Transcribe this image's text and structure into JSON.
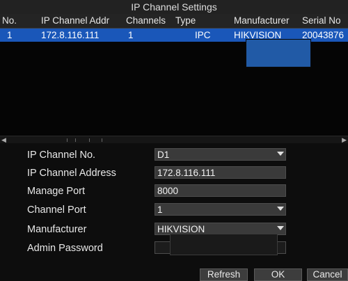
{
  "window": {
    "title": "IP Channel Settings"
  },
  "table": {
    "columns": [
      "No.",
      "IP Channel Addr",
      "Channels",
      "Type",
      "Manufacturer",
      "Serial No"
    ],
    "rows": [
      {
        "no": "1",
        "address": "172.8.116.111",
        "channels": "1",
        "type": "IPC",
        "manufacturer": "HIKVISION",
        "serial": "20043876"
      }
    ]
  },
  "form": {
    "channel_no": {
      "label": "IP Channel No.",
      "value": "D1"
    },
    "channel_address": {
      "label": "IP Channel Address",
      "value": "172.8.116.111"
    },
    "manage_port": {
      "label": "Manage Port",
      "value": "8000"
    },
    "channel_port": {
      "label": "Channel Port",
      "value": "1"
    },
    "manufacturer": {
      "label": "Manufacturer",
      "value": "HIKVISION"
    },
    "admin_password": {
      "label": "Admin Password",
      "value": ""
    }
  },
  "buttons": {
    "refresh": "Refresh",
    "ok": "OK",
    "cancel": "Cancel"
  },
  "colors": {
    "selection": "#1a57b9",
    "redaction": "#215aa6",
    "field_bg": "#3a3a3a",
    "window_bg": "#111111"
  }
}
